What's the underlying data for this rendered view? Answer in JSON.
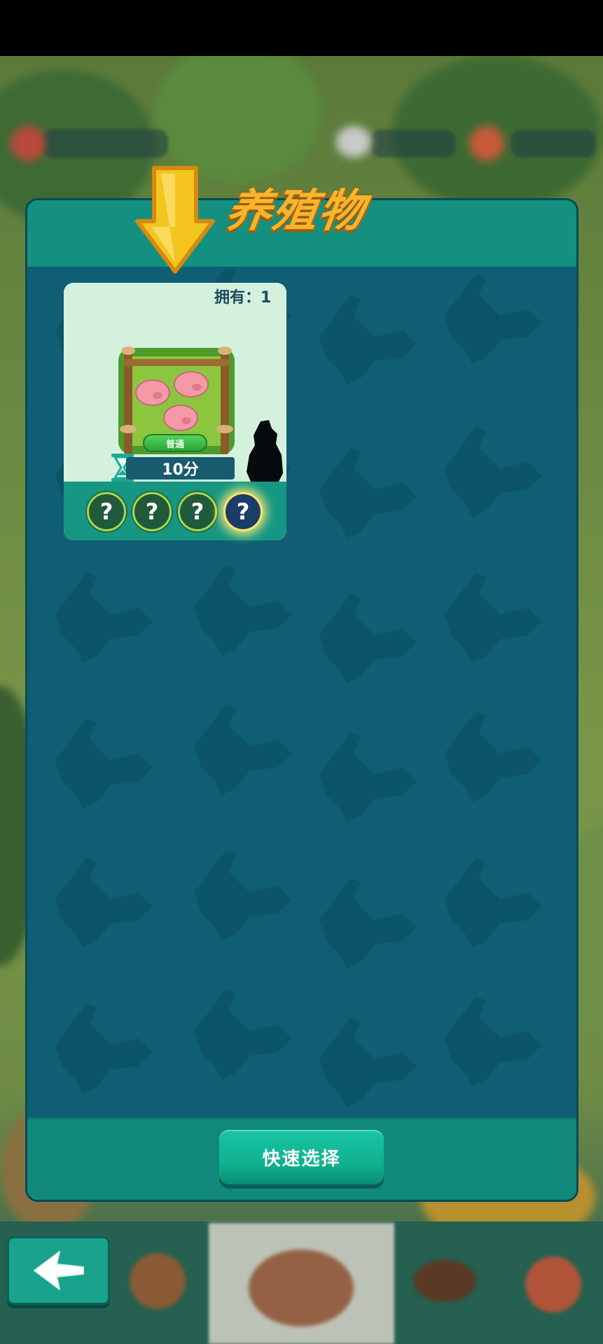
{
  "panel": {
    "title": "养殖物",
    "quick_select_label": "快速选择"
  },
  "card": {
    "owned_label": "拥有：1",
    "rarity_label": "普通",
    "timer_label": "10分",
    "slots": [
      {
        "label": "?",
        "active": false
      },
      {
        "label": "?",
        "active": false
      },
      {
        "label": "?",
        "active": false
      },
      {
        "label": "?",
        "active": true
      }
    ]
  },
  "icons": {
    "arrow": "down-arrow-icon",
    "hourglass": "hourglass-icon",
    "back": "back-arrow-icon"
  },
  "colors": {
    "panel_bg": "#0f5e73",
    "header": "#13907f",
    "title": "#f7b52a",
    "button": "#18c6a3"
  }
}
